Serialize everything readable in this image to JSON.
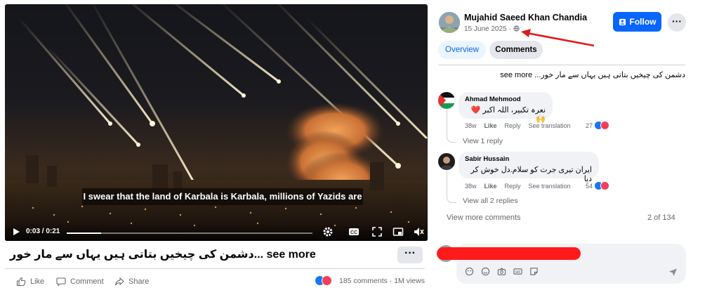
{
  "video": {
    "caption": "I swear that the land of Karbala is Karbala, millions of Yazids are",
    "time": "0:03 / 0:21",
    "progress_fraction": 0.14
  },
  "post": {
    "text": "دشمن کی چیخیں بتاتی ہیں یہاں سے مار خور... see more",
    "more_label": "···",
    "actions": {
      "like": "Like",
      "comment": "Comment",
      "share": "Share"
    },
    "stats": "185 comments · 1M views"
  },
  "author": {
    "name": "Mujahid Saeed Khan Chandia",
    "date": "15 June 2025 ·",
    "follow_label": "Follow",
    "menu_label": "···"
  },
  "tabs": [
    {
      "label": "Overview",
      "active": true
    },
    {
      "label": "Comments",
      "active": false
    }
  ],
  "description": "دشمن کی چیخیں بتاتی ہیں یہاں سے مار خور... see more",
  "comments": [
    {
      "name": "Ahmad Mehmood",
      "text": "نعرہ تکبیر، اللہ اکبر ❤️🙌",
      "age": "38w",
      "like": "Like",
      "reply": "Reply",
      "translate": "See translation",
      "reactions": "27",
      "replies_link": "View 1 reply"
    },
    {
      "name": "Sabir Hussain",
      "text": "ایران تیری جرت کو سلام.دل خوش کر دیا",
      "age": "38w",
      "like": "Like",
      "reply": "Reply",
      "translate": "See translation",
      "reactions": "54",
      "replies_link": "View all 2 replies"
    }
  ],
  "view_more_comments": "View more comments",
  "page_count": "2 of 134",
  "colors": {
    "accent": "#0866ff",
    "annotation": "#e01b1b",
    "redaction": "#ff1a1a"
  }
}
